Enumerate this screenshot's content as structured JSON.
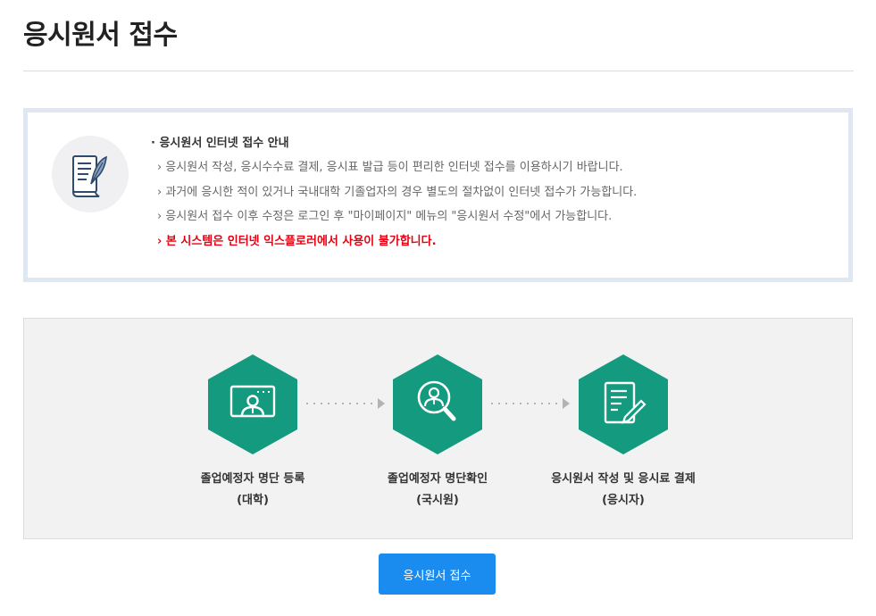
{
  "page": {
    "title": "응시원서 접수"
  },
  "notice": {
    "heading": "· 응시원서 인터넷 접수 안내",
    "lines": [
      "› 응시원서 작성, 응시수수료 결제, 응시표 발급 등이 편리한 인터넷 접수를 이용하시기 바랍니다.",
      "› 과거에 응시한 적이 있거나 국내대학 기졸업자의 경우 별도의 절차없이 인터넷 접수가 가능합니다.",
      "› 응시원서 접수 이후 수정은 로그인 후 \"마이페이지\" 메뉴의 \"응시원서 수정\"에서 가능합니다."
    ],
    "warning": "› 본 시스템은 인터넷 익스플로러에서 사용이 불가합니다."
  },
  "steps": [
    {
      "label": "졸업예정자 명단 등록",
      "sub": "(대학)",
      "icon": "monitor-person-icon"
    },
    {
      "label": "졸업예정자 명단확인",
      "sub": "(국시원)",
      "icon": "magnifier-person-icon"
    },
    {
      "label": "응시원서 작성 및 응시료 결제",
      "sub": "(응시자)",
      "icon": "document-pen-icon"
    }
  ],
  "button": {
    "label": "응시원서 접수"
  },
  "colors": {
    "accent": "#1a8cf0",
    "hex": "#139a7f",
    "warning": "#e60012",
    "notice_border": "#dfe8f2"
  }
}
